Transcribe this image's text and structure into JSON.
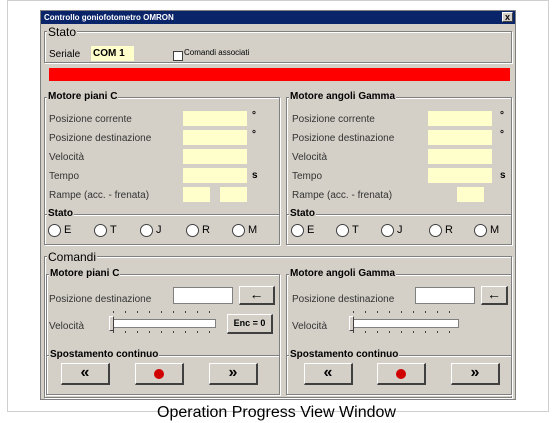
{
  "window": {
    "title": "Controllo goniofotometro OMRON",
    "close": "x"
  },
  "stato": {
    "heading": "Stato",
    "seriale_label": "Seriale",
    "seriale_value": "COM 1",
    "comandi_associati_label": "Comandi associati",
    "comandi_associati_checked": false,
    "status_bar_color": "#ff0000"
  },
  "motore_c": {
    "heading": "Motore piani C",
    "rows": [
      "Posizione corrente",
      "Posizione destinazione",
      "Velocità",
      "Tempo",
      "Rampe (acc. - frenata)"
    ],
    "units": [
      "°",
      "°",
      "",
      "s",
      ""
    ],
    "stato_heading": "Stato",
    "radios": [
      "E",
      "T",
      "J",
      "R",
      "M"
    ]
  },
  "motore_gamma": {
    "heading": "Motore angoli Gamma",
    "rows": [
      "Posizione corrente",
      "Posizione destinazione",
      "Velocità",
      "Tempo",
      "Rampe (acc. - frenata)"
    ],
    "units": [
      "°",
      "°",
      "",
      "s",
      ""
    ],
    "stato_heading": "Stato",
    "radios": [
      "E",
      "T",
      "J",
      "R",
      "M"
    ]
  },
  "comandi": {
    "heading": "Comandi",
    "c": {
      "heading": "Motore piani C",
      "pos_label": "Posizione destinazione",
      "pos_value": "",
      "vel_label": "Velocità",
      "enc_button": "Enc = 0",
      "spost_heading": "Spostamento continuo"
    },
    "gamma": {
      "heading": "Motore angoli Gamma",
      "pos_label": "Posizione destinazione",
      "pos_value": "",
      "vel_label": "Velocità",
      "spost_heading": "Spostamento continuo"
    },
    "icons": {
      "go": "arrow-left-icon",
      "back": "rewind-icon",
      "stop": "stop-icon",
      "fwd": "fast-forward-icon"
    }
  },
  "caption": "Operation Progress View Window"
}
